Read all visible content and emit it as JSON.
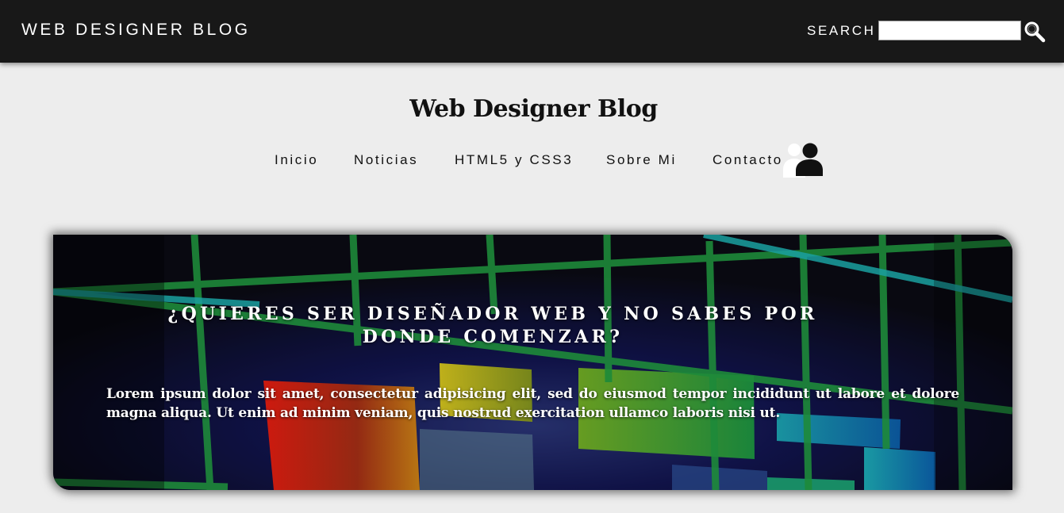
{
  "topbar": {
    "brand": "WEB DESIGNER BLOG",
    "search_label": "SEARCH",
    "search_value": "",
    "search_icon": "magnifier-icon"
  },
  "header": {
    "title": "Web Designer Blog"
  },
  "nav": {
    "items": [
      {
        "label": "Inicio"
      },
      {
        "label": "Noticias"
      },
      {
        "label": "HTML5 y CSS3"
      },
      {
        "label": "Sobre Mi"
      },
      {
        "label": "Contacto"
      }
    ],
    "user_icon": "users-icon"
  },
  "hero": {
    "title": "¿QUIERES SER DISEÑADOR WEB Y NO SABES POR DONDE COMENZAR?",
    "text": "Lorem ipsum dolor sit amet, consectetur adipisicing elit, sed do eiusmod tempor incididunt ut labore et dolore magna aliqua. Ut enim ad minim veniam, quis nostrud exercitation ullamco laboris nisi ut."
  },
  "colors": {
    "topbar_bg": "#181818",
    "page_bg": "#ededed",
    "grid_green": "#1e8a3a",
    "panel_red": "#c01a10",
    "panel_yellow": "#b8b014"
  }
}
